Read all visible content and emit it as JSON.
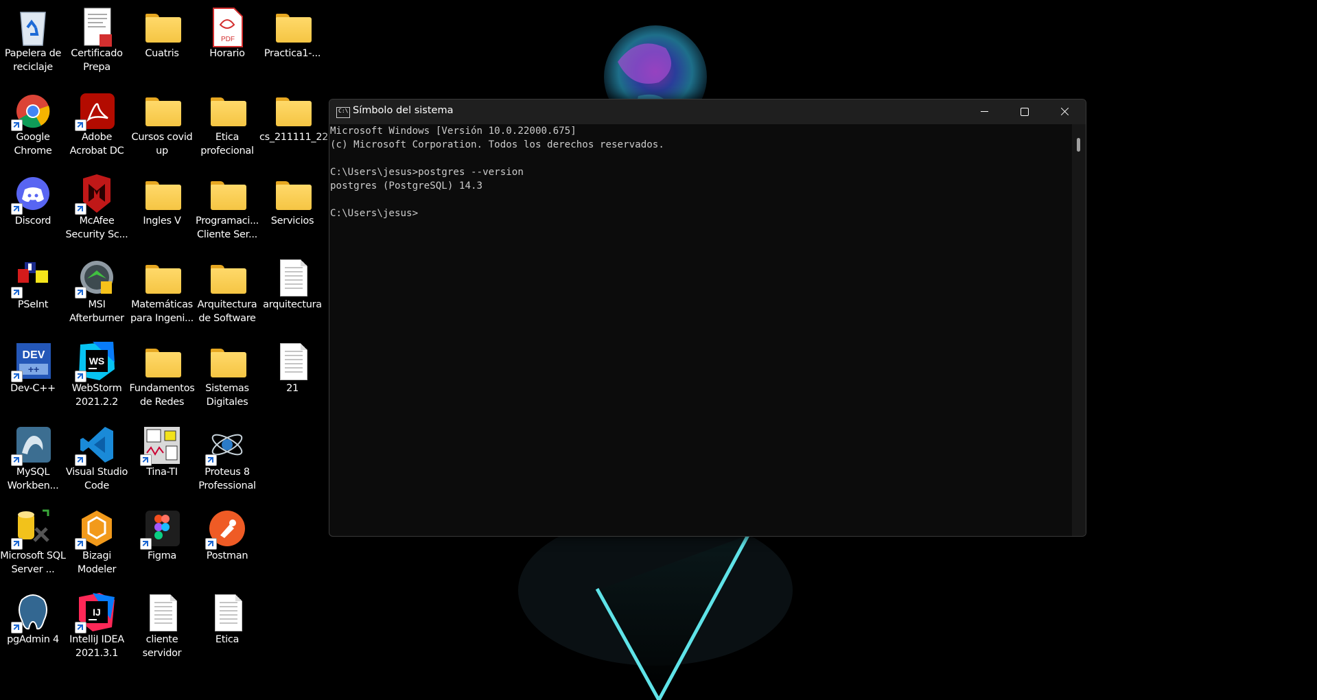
{
  "desktop": {
    "icons": [
      {
        "label": "Papelera de reciclaje",
        "icon": "recycle-bin-icon"
      },
      {
        "label": "Certificado Prepa",
        "icon": "pdf-document-icon"
      },
      {
        "label": "Cuatris",
        "icon": "folder-icon"
      },
      {
        "label": "Horario",
        "icon": "pdf-icon"
      },
      {
        "label": "Practica1-...",
        "icon": "folder-icon"
      },
      {
        "label": "Google Chrome",
        "icon": "chrome-icon"
      },
      {
        "label": "Adobe Acrobat DC",
        "icon": "acrobat-icon"
      },
      {
        "label": "Cursos covid up",
        "icon": "folder-icon"
      },
      {
        "label": "Etica profecional",
        "icon": "folder-icon"
      },
      {
        "label": "cs_211111_22",
        "icon": "folder-icon"
      },
      {
        "label": "Discord",
        "icon": "discord-icon"
      },
      {
        "label": "McAfee Security Sc...",
        "icon": "mcafee-icon"
      },
      {
        "label": "Ingles V",
        "icon": "folder-icon"
      },
      {
        "label": "Programaci... Cliente Ser...",
        "icon": "folder-icon"
      },
      {
        "label": "Servicios",
        "icon": "folder-icon"
      },
      {
        "label": "PSeInt",
        "icon": "pseint-icon"
      },
      {
        "label": "MSI Afterburner",
        "icon": "msi-afterburner-icon"
      },
      {
        "label": "Matemáticas para Ingeni...",
        "icon": "folder-icon"
      },
      {
        "label": "Arquitectura de Software",
        "icon": "folder-icon"
      },
      {
        "label": "arquitectura",
        "icon": "text-document-icon"
      },
      {
        "label": "Dev-C++",
        "icon": "devcpp-icon"
      },
      {
        "label": "WebStorm 2021.2.2",
        "icon": "webstorm-icon"
      },
      {
        "label": "Fundamentos de Redes",
        "icon": "folder-icon"
      },
      {
        "label": "Sistemas Digitales",
        "icon": "folder-icon"
      },
      {
        "label": "21",
        "icon": "text-document-icon"
      },
      {
        "label": "MySQL Workben...",
        "icon": "mysql-workbench-icon"
      },
      {
        "label": "Visual Studio Code",
        "icon": "vscode-icon"
      },
      {
        "label": "Tina-TI",
        "icon": "tina-ti-icon"
      },
      {
        "label": "Proteus 8 Professional",
        "icon": "proteus-icon"
      },
      {
        "label": "Microsoft SQL Server ...",
        "icon": "sql-server-icon"
      },
      {
        "label": "Bizagi Modeler",
        "icon": "bizagi-icon"
      },
      {
        "label": "Figma",
        "icon": "figma-icon"
      },
      {
        "label": "Postman",
        "icon": "postman-icon"
      },
      {
        "label": "pgAdmin 4",
        "icon": "pgadmin-icon"
      },
      {
        "label": "IntelliJ IDEA 2021.3.1",
        "icon": "intellij-icon"
      },
      {
        "label": "cliente servidor",
        "icon": "text-document-icon"
      },
      {
        "label": "Etica",
        "icon": "text-document-icon"
      }
    ]
  },
  "cmd_window": {
    "title": "Símbolo del sistema",
    "lines": [
      "Microsoft Windows [Versión 10.0.22000.675]",
      "(c) Microsoft Corporation. Todos los derechos reservados.",
      "",
      "C:\\Users\\jesus>postgres --version",
      "postgres (PostgreSQL) 14.3",
      "",
      "C:\\Users\\jesus>"
    ]
  },
  "colors": {
    "desktop_bg": "#000000",
    "console_bg": "#0c0c0c",
    "console_text": "#cccccc",
    "titlebar_bg": "#1f1f1f"
  }
}
